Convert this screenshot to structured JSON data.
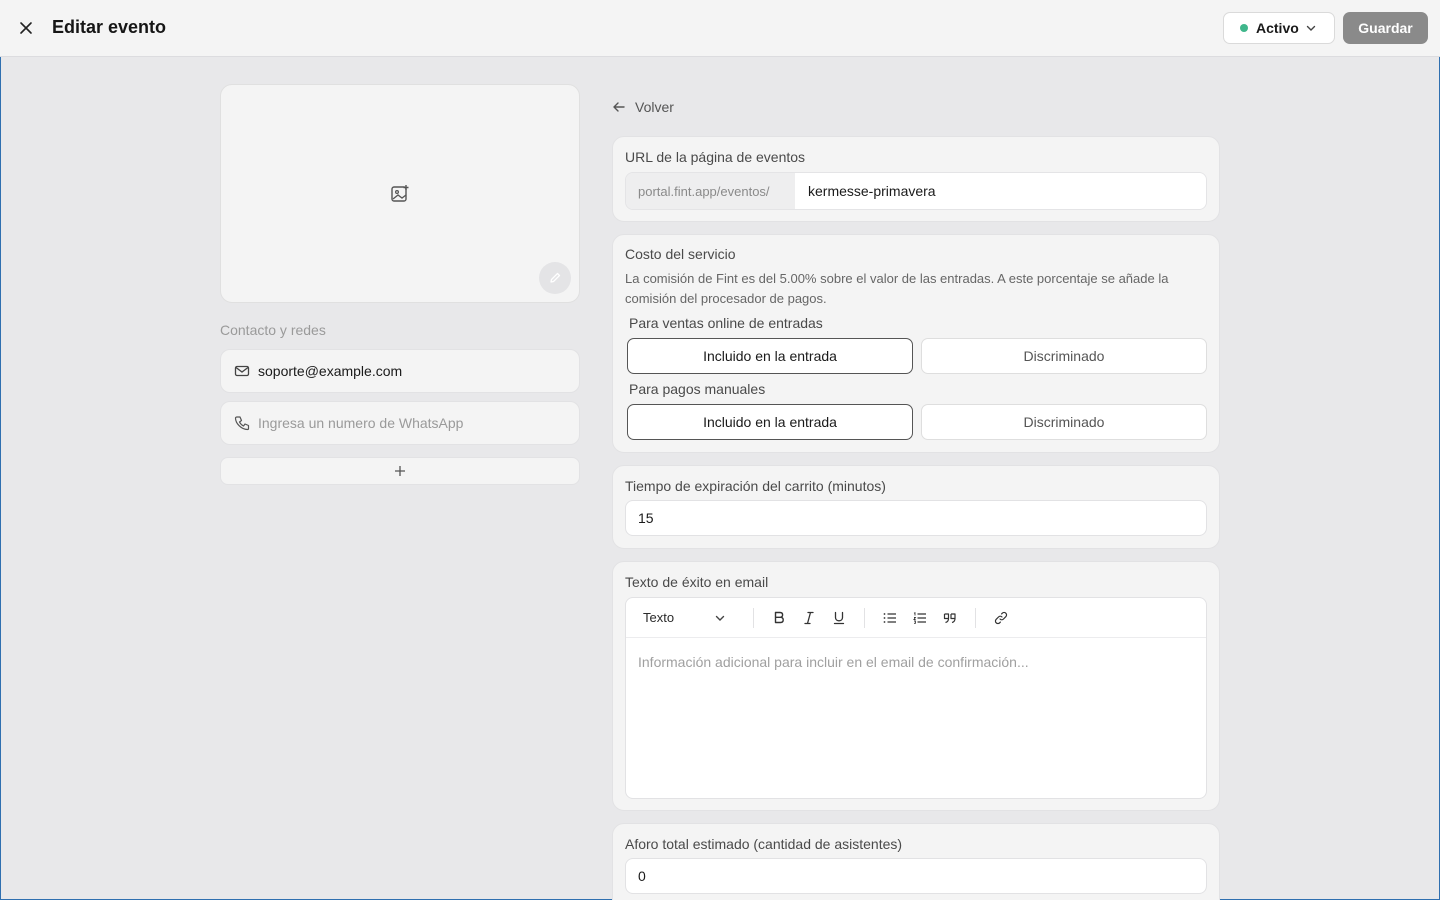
{
  "header": {
    "title": "Editar evento",
    "status": {
      "label": "Activo",
      "dot_color": "#3fb68b"
    },
    "save_label": "Guardar"
  },
  "left": {
    "contact_section_label": "Contacto y redes",
    "email": {
      "value": "soporte@example.com"
    },
    "whatsapp": {
      "value": "",
      "placeholder": "Ingresa un numero de WhatsApp"
    }
  },
  "back_label": "Volver",
  "url_card": {
    "label": "URL de la página de eventos",
    "prefix": "portal.fint.app/eventos/",
    "slug": "kermesse-primavera"
  },
  "service_cost": {
    "label": "Costo del servicio",
    "description": "La comisión de Fint es del 5.00% sobre el valor de las entradas. A este porcentaje se añade la comisión del procesador de pagos.",
    "online": {
      "label": "Para ventas online de entradas",
      "options": [
        "Incluido en la entrada",
        "Discriminado"
      ],
      "selected": "Incluido en la entrada"
    },
    "manual": {
      "label": "Para pagos manuales",
      "options": [
        "Incluido en la entrada",
        "Discriminado"
      ],
      "selected": "Incluido en la entrada"
    }
  },
  "cart_expiry": {
    "label": "Tiempo de expiración del carrito (minutos)",
    "value": "15"
  },
  "email_text": {
    "label": "Texto de éxito en email",
    "toolbar": {
      "format_select": "Texto",
      "buttons": [
        "bold-icon",
        "italic-icon",
        "underline-icon",
        "bullet-list-icon",
        "numbered-list-icon",
        "quote-icon",
        "link-icon"
      ]
    },
    "placeholder": "Información adicional para incluir en el email de confirmación..."
  },
  "capacity": {
    "label": "Aforo total estimado (cantidad de asistentes)",
    "value": "0"
  }
}
